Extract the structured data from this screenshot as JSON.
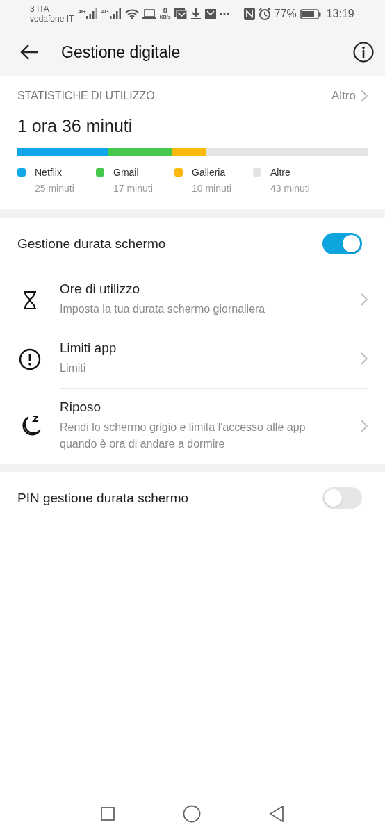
{
  "status_bar": {
    "carriers": [
      "3 ITA",
      "vodafone IT"
    ],
    "network_labels": [
      "4G",
      "4G"
    ],
    "speed": {
      "value": "0",
      "unit": "KB/s"
    },
    "battery": "77%",
    "time": "13:19"
  },
  "header": {
    "title": "Gestione digitale"
  },
  "usage": {
    "heading": "STATISTICHE DI UTILIZZO",
    "more": "Altro",
    "total": "1 ora 36 minuti",
    "apps": [
      {
        "name": "Netflix",
        "time": "25 minuti",
        "color": "#12a7ea"
      },
      {
        "name": "Gmail",
        "time": "17 minuti",
        "color": "#44c84e"
      },
      {
        "name": "Galleria",
        "time": "10 minuti",
        "color": "#fbb80f"
      },
      {
        "name": "Altre",
        "time": "43 minuti",
        "color": "#e3e3e3"
      }
    ]
  },
  "settings": [
    {
      "kind": "toggle",
      "label": "Gestione durata schermo",
      "on": true
    },
    {
      "kind": "link",
      "label": "Ore di utilizzo",
      "detail": "Imposta la tua durata schermo giornaliera"
    },
    {
      "kind": "link",
      "label": "Limiti app",
      "detail": "Limiti"
    },
    {
      "kind": "link",
      "label": "Riposo",
      "detail": "Rendi lo schermo grigio e limita l'accesso alle app quando è ora di andare a dormire"
    }
  ],
  "pin": {
    "label": "PIN gestione durata schermo",
    "on": false
  }
}
